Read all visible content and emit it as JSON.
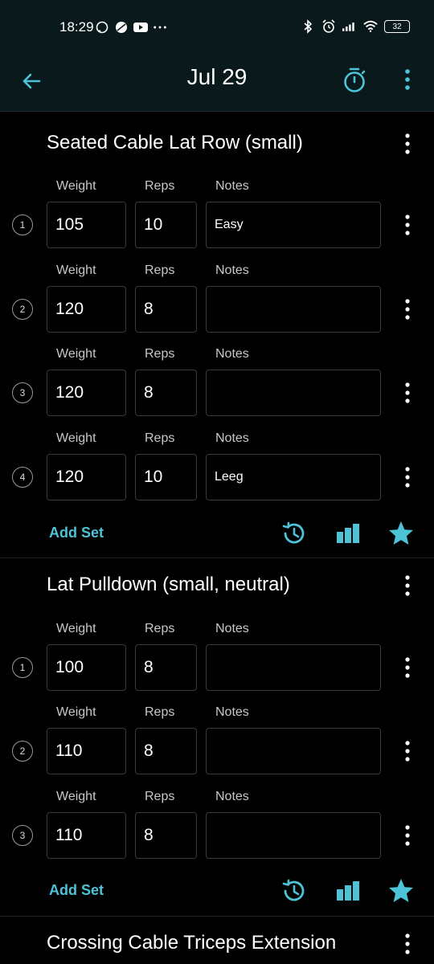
{
  "status_bar": {
    "time": "18:29",
    "battery": "32",
    "left_icons": [
      "whatsapp-icon",
      "pinwheel-icon",
      "youtube-icon",
      "more-dots-icon"
    ],
    "right_icons": [
      "bluetooth-icon",
      "alarm-icon",
      "signal-icon",
      "wifi-icon",
      "battery-icon"
    ]
  },
  "app_bar": {
    "title": "Jul 29",
    "back_icon": "arrow-left-icon",
    "timer_icon": "stopwatch-icon",
    "menu_icon": "more-vert-icon"
  },
  "colors": {
    "accent": "#4dc3d8",
    "background": "#000000",
    "bar": "#0a1a1c"
  },
  "labels": {
    "weight": "Weight",
    "reps": "Reps",
    "notes": "Notes",
    "add_set": "Add Set"
  },
  "exercises": [
    {
      "name": "Seated Cable Lat Row (small)",
      "sets": [
        {
          "num": "1",
          "weight": "105",
          "reps": "10",
          "notes": "Easy"
        },
        {
          "num": "2",
          "weight": "120",
          "reps": "8",
          "notes": ""
        },
        {
          "num": "3",
          "weight": "120",
          "reps": "8",
          "notes": ""
        },
        {
          "num": "4",
          "weight": "120",
          "reps": "10",
          "notes": "Leeg"
        }
      ]
    },
    {
      "name": "Lat Pulldown (small, neutral)",
      "sets": [
        {
          "num": "1",
          "weight": "100",
          "reps": "8",
          "notes": ""
        },
        {
          "num": "2",
          "weight": "110",
          "reps": "8",
          "notes": ""
        },
        {
          "num": "3",
          "weight": "110",
          "reps": "8",
          "notes": ""
        }
      ]
    },
    {
      "name": "Crossing Cable Triceps Extension",
      "sets": []
    }
  ]
}
